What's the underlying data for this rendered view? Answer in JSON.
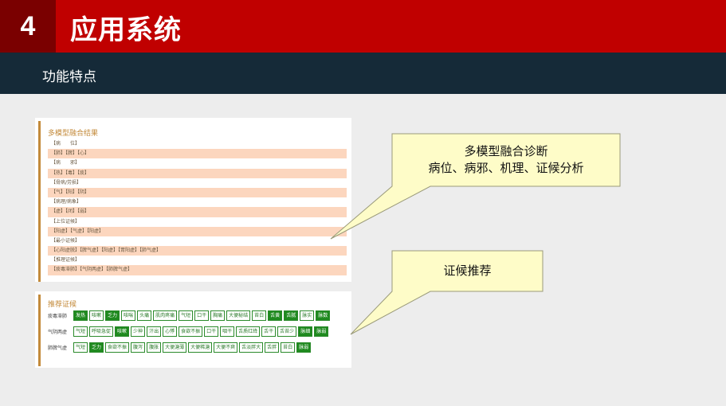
{
  "header": {
    "number": "4",
    "title": "应用系统"
  },
  "subheader": {
    "title": "功能特点"
  },
  "fusion_panel": {
    "title": "多模型融合结果",
    "rows": [
      "【病　　位】",
      "【肺】【脾】【心】",
      "【病　　邪】",
      "【热】【毒】【痰】",
      "【骨病/劳损】",
      "【气】【阳】【阴】",
      "【病理/病象】",
      "【虚】【闭】【弱】",
      "【上位证候】",
      "【阳虚】【气虚】【阳虚】",
      "【最小证候】",
      "【心阳虚脱】【脾气虚】【阳虚】【胃阳虚】【肺气虚】",
      "【推理证候】",
      "【痰毒滞肺】【气阴两虚】【肺脾气虚】"
    ]
  },
  "recommend_panel": {
    "title": "推荐证候",
    "groups": [
      {
        "label": "痰毒滞肺",
        "tags": [
          {
            "text": "发热",
            "on": true
          },
          {
            "text": "咳嗽",
            "on": false
          },
          {
            "text": "乏力",
            "on": true
          },
          {
            "text": "咳喘",
            "on": false
          },
          {
            "text": "头痛",
            "on": false
          },
          {
            "text": "肌肉疼痛",
            "on": false
          },
          {
            "text": "气短",
            "on": false
          },
          {
            "text": "口干",
            "on": false
          },
          {
            "text": "胸痛",
            "on": false
          },
          {
            "text": "大便秘结",
            "on": false
          },
          {
            "text": "苔白",
            "on": false
          },
          {
            "text": "舌黄",
            "on": true
          },
          {
            "text": "舌腻",
            "on": true
          },
          {
            "text": "脉实",
            "on": false
          },
          {
            "text": "脉数",
            "on": true
          }
        ]
      },
      {
        "label": "气阴两虚",
        "tags": [
          {
            "text": "气短",
            "on": false
          },
          {
            "text": "呼吸急促",
            "on": false
          },
          {
            "text": "咳嗽",
            "on": true
          },
          {
            "text": "少神",
            "on": false
          },
          {
            "text": "汗出",
            "on": false
          },
          {
            "text": "心悸",
            "on": false
          },
          {
            "text": "食欲不振",
            "on": false
          },
          {
            "text": "口干",
            "on": false
          },
          {
            "text": "咽干",
            "on": false
          },
          {
            "text": "舌质红绛",
            "on": false
          },
          {
            "text": "舌干",
            "on": false
          },
          {
            "text": "舌苔少",
            "on": false
          },
          {
            "text": "脉细",
            "on": true
          },
          {
            "text": "脉弱",
            "on": true
          }
        ]
      },
      {
        "label": "肺脾气虚",
        "tags": [
          {
            "text": "气短",
            "on": false
          },
          {
            "text": "乏力",
            "on": true
          },
          {
            "text": "食欲不振",
            "on": false
          },
          {
            "text": "腹泻",
            "on": false
          },
          {
            "text": "腹胀",
            "on": false
          },
          {
            "text": "大便溏薄",
            "on": false
          },
          {
            "text": "大便稀溏",
            "on": false
          },
          {
            "text": "大便不爽",
            "on": false
          },
          {
            "text": "舌淡胖大",
            "on": false
          },
          {
            "text": "舌胖",
            "on": false
          },
          {
            "text": "苔白",
            "on": false
          },
          {
            "text": "脉弱",
            "on": true
          }
        ]
      }
    ]
  },
  "callouts": {
    "fusion_line1": "多模型融合诊断",
    "fusion_line2": "病位、病邪、机理、证候分析",
    "recommend": "证候推荐"
  },
  "colors": {
    "header_red": "#c00000",
    "number_box": "#7a0000",
    "subbar": "#152a38",
    "row_shade": "#fcd6be",
    "tag_green": "#1f8a1f",
    "callout_fill": "#fefcc8"
  }
}
